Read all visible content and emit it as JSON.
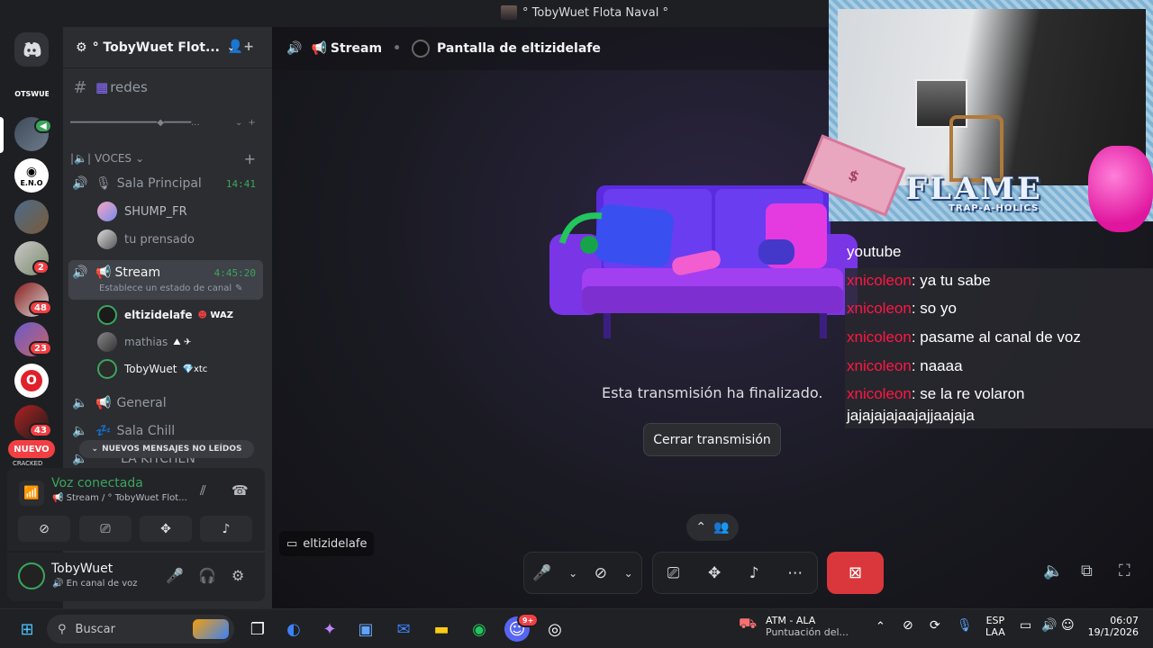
{
  "window": {
    "title": "° TobyWuet Flota Naval °"
  },
  "rail": {
    "badges": [
      "2",
      "48",
      "23",
      "43"
    ],
    "server_labels": [
      "OOTSWUET",
      "E.N.O",
      "CRACKED"
    ],
    "nuevo": "NUEVO"
  },
  "server": {
    "name": "° TobyWuet Flot...",
    "chev": "⌄"
  },
  "channels": {
    "redes": "redes",
    "divider": "━━━━━━━━━━━━━━━━◆━━━━━...",
    "category": "VOCES",
    "sala_principal": {
      "name": "Sala Principal",
      "time": "14:41"
    },
    "sala_principal_members": [
      "SHUMP_FR",
      "tu prensado"
    ],
    "stream": {
      "name": "Stream",
      "time": "4:45:20",
      "status": "Establece un estado de canal"
    },
    "stream_members": [
      {
        "name": "eltizidelafe",
        "tag": "WAZ"
      },
      {
        "name": "mathias",
        "tag": ""
      },
      {
        "name": "TobyWuet",
        "tag": "xtc"
      }
    ],
    "general": "General",
    "sala_chill": "Sala Chill",
    "kitchen": "LA KITCHEN",
    "new_messages": "NUEVOS MENSAJES NO LEÍDOS"
  },
  "voice": {
    "state": "Voz conectada",
    "location": "Stream / ° TobyWuet Flot..."
  },
  "user": {
    "name": "TobyWuet",
    "status": "En canal de voz"
  },
  "main": {
    "channel": "Stream",
    "screen": "Pantalla de eltizidelafe",
    "ended_message": "Esta transmisión ha finalizado.",
    "close_button": "Cerrar transmisión",
    "streamer": "eltizidelafe"
  },
  "overlay": {
    "banner": "FLAME",
    "banner_sub": "TRAP-A-HOLICS",
    "chat": [
      {
        "user": "",
        "text": "youtube"
      },
      {
        "user": "xnicoleon",
        "text": ": ya tu sabe"
      },
      {
        "user": "xnicoleon",
        "text": ": so yo"
      },
      {
        "user": "xnicoleon",
        "text": ": pasame al canal de voz"
      },
      {
        "user": "xnicoleon",
        "text": ": naaaa"
      },
      {
        "user": "xnicoleon",
        "text": ": se la re volaron"
      },
      {
        "user": "",
        "text": "jajajajajaajajjaajaja"
      }
    ]
  },
  "taskbar": {
    "search_placeholder": "Buscar",
    "discord_badge": "9+",
    "weather_title": "ATM - ALA",
    "weather_sub": "Puntuación del...",
    "lang1": "ESP",
    "lang2": "LAA",
    "time": "06:07",
    "date": "19/1/2026"
  },
  "colors": {
    "accent_green": "#3ba55d",
    "danger": "#da373c",
    "chat_user": "#ff1744"
  }
}
